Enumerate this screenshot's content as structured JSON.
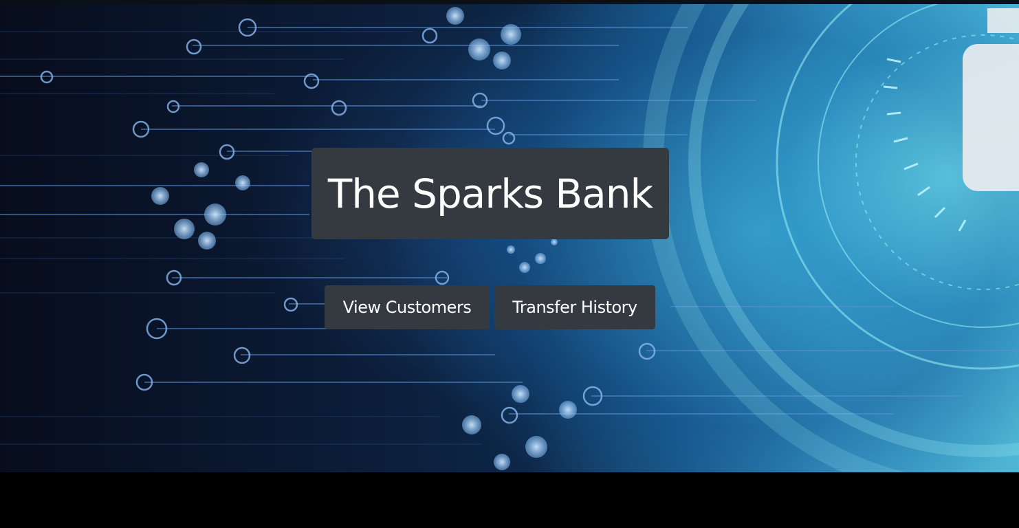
{
  "hero": {
    "title": "The Sparks Bank",
    "background_description_icon": "circuit-board-lock-icon"
  },
  "buttons": {
    "view_customers": "View Customers",
    "transfer_history": "Transfer History"
  },
  "colors": {
    "button_bg": "#343a40",
    "button_text": "#ffffff",
    "page_bg": "#000000",
    "accent_cyan": "#4fb6d6"
  }
}
